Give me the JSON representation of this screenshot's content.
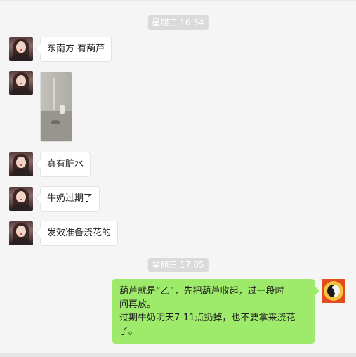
{
  "timestamps": [
    "星期三 16:54",
    "星期三 17:05"
  ],
  "messages": [
    {
      "text": "东南方 有葫芦"
    },
    {
      "text": "真有脏水"
    },
    {
      "text": "牛奶过期了"
    },
    {
      "text": "发效准备浇花的"
    }
  ],
  "reply": {
    "line1": "葫芦就是“乙”，先把葫芦收起，过一段时",
    "line2": "间再放。",
    "line3": "过期牛奶明天7-11点扔掉，也不要拿来浇花",
    "line4": "了。"
  },
  "icons": {
    "left_avatar": "woman-portrait-avatar",
    "right_avatar": "yin-yang-bagua-avatar",
    "photo": "bathroom-photo-thumbnail"
  },
  "colors": {
    "sent_bubble": "#9eea6a",
    "received_bubble": "#ffffff",
    "timestamp_bg": "#dadada",
    "background": "#f5f5f5"
  }
}
